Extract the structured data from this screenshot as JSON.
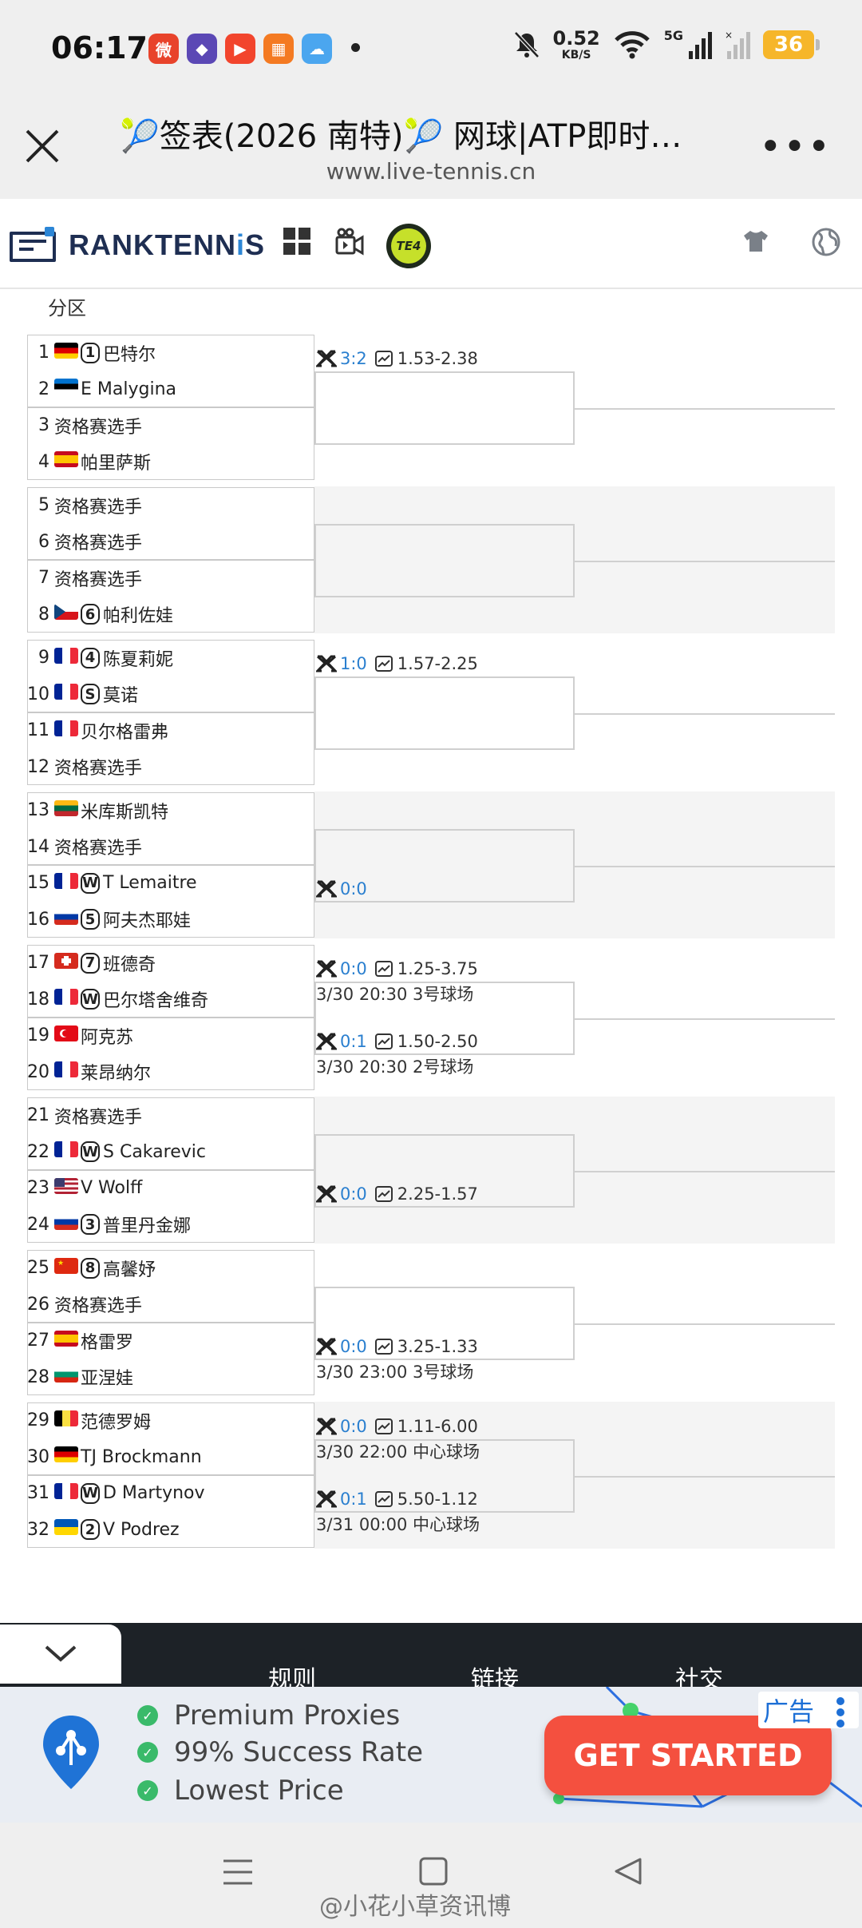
{
  "status_bar": {
    "time": "06:17",
    "net_speed": "0.52",
    "net_unit": "KB/S",
    "network": "5G",
    "battery": "36"
  },
  "browser": {
    "title": "🎾签表(2026 南特)🎾 网球|ATP即时…",
    "url": "www.live-tennis.cn"
  },
  "site": {
    "logo_main": "RANKTENN",
    "logo_accent": "i",
    "logo_end": "S",
    "te4": "TE4"
  },
  "section": "分区",
  "colors": {
    "accent_blue": "#2a7fcf",
    "brand_navy": "#1e2e52",
    "cta_red": "#f4503f"
  },
  "players": [
    {
      "num": "1",
      "flag": "de",
      "seed": "1",
      "name": "巴特尔"
    },
    {
      "num": "2",
      "flag": "ee",
      "seed": "",
      "name": "E Malygina"
    },
    {
      "num": "3",
      "flag": "",
      "seed": "",
      "name": "资格赛选手"
    },
    {
      "num": "4",
      "flag": "es",
      "seed": "",
      "name": "帕里萨斯"
    },
    {
      "num": "5",
      "flag": "",
      "seed": "",
      "name": "资格赛选手"
    },
    {
      "num": "6",
      "flag": "",
      "seed": "",
      "name": "资格赛选手"
    },
    {
      "num": "7",
      "flag": "",
      "seed": "",
      "name": "资格赛选手"
    },
    {
      "num": "8",
      "flag": "cz",
      "seed": "6",
      "name": "帕利佐娃"
    },
    {
      "num": "9",
      "flag": "fr",
      "seed": "4",
      "name": "陈夏莉妮"
    },
    {
      "num": "10",
      "flag": "fr",
      "seed": "S",
      "name": "莫诺"
    },
    {
      "num": "11",
      "flag": "fr",
      "seed": "",
      "name": "贝尔格雷弗"
    },
    {
      "num": "12",
      "flag": "",
      "seed": "",
      "name": "资格赛选手"
    },
    {
      "num": "13",
      "flag": "lt",
      "seed": "",
      "name": "米库斯凯特"
    },
    {
      "num": "14",
      "flag": "",
      "seed": "",
      "name": "资格赛选手"
    },
    {
      "num": "15",
      "flag": "fr",
      "seed": "W",
      "name": "T Lemaitre"
    },
    {
      "num": "16",
      "flag": "ru",
      "seed": "5",
      "name": "阿夫杰耶娃"
    },
    {
      "num": "17",
      "flag": "ch",
      "seed": "7",
      "name": "班德奇"
    },
    {
      "num": "18",
      "flag": "fr",
      "seed": "W",
      "name": "巴尔塔舍维奇"
    },
    {
      "num": "19",
      "flag": "tr",
      "seed": "",
      "name": "阿克苏"
    },
    {
      "num": "20",
      "flag": "fr",
      "seed": "",
      "name": "莱昂纳尔"
    },
    {
      "num": "21",
      "flag": "",
      "seed": "",
      "name": "资格赛选手"
    },
    {
      "num": "22",
      "flag": "fr",
      "seed": "W",
      "name": "S Cakarevic"
    },
    {
      "num": "23",
      "flag": "us",
      "seed": "",
      "name": "V Wolff"
    },
    {
      "num": "24",
      "flag": "ru",
      "seed": "3",
      "name": "普里丹金娜"
    },
    {
      "num": "25",
      "flag": "cn",
      "seed": "8",
      "name": "高馨妤"
    },
    {
      "num": "26",
      "flag": "",
      "seed": "",
      "name": "资格赛选手"
    },
    {
      "num": "27",
      "flag": "es",
      "seed": "",
      "name": "格雷罗"
    },
    {
      "num": "28",
      "flag": "bg",
      "seed": "",
      "name": "亚涅娃"
    },
    {
      "num": "29",
      "flag": "be",
      "seed": "",
      "name": "范德罗姆"
    },
    {
      "num": "30",
      "flag": "de",
      "seed": "",
      "name": "TJ Brockmann"
    },
    {
      "num": "31",
      "flag": "fr",
      "seed": "W",
      "name": "D Martynov"
    },
    {
      "num": "32",
      "flag": "ua",
      "seed": "2",
      "name": "V Podrez"
    }
  ],
  "matches": [
    {
      "pair": 1,
      "h2h": "3:2",
      "odds": "1.53-2.38",
      "schedule": ""
    },
    {
      "pair": 5,
      "h2h": "1:0",
      "odds": "1.57-2.25",
      "schedule": ""
    },
    {
      "pair": 8,
      "h2h": "0:0",
      "odds": "",
      "schedule": ""
    },
    {
      "pair": 9,
      "h2h": "0:0",
      "odds": "1.25-3.75",
      "schedule": "3/30 20:30 3号球场"
    },
    {
      "pair": 10,
      "h2h": "0:1",
      "odds": "1.50-2.50",
      "schedule": "3/30 20:30 2号球场"
    },
    {
      "pair": 12,
      "h2h": "0:0",
      "odds": "2.25-1.57",
      "schedule": ""
    },
    {
      "pair": 14,
      "h2h": "0:0",
      "odds": "3.25-1.33",
      "schedule": "3/30 23:00 3号球场"
    },
    {
      "pair": 15,
      "h2h": "0:0",
      "odds": "1.11-6.00",
      "schedule": "3/30 22:00 中心球场"
    },
    {
      "pair": 16,
      "h2h": "0:1",
      "odds": "5.50-1.12",
      "schedule": "3/31 00:00 中心球场"
    }
  ],
  "footer": {
    "tabs": [
      "规则",
      "链接",
      "社交"
    ]
  },
  "ad": {
    "items": [
      "Premium Proxies",
      "99% Success Rate",
      "Lowest Price"
    ],
    "cta": "GET STARTED",
    "tag": "广告"
  },
  "watermark": "@小花小草资讯博"
}
